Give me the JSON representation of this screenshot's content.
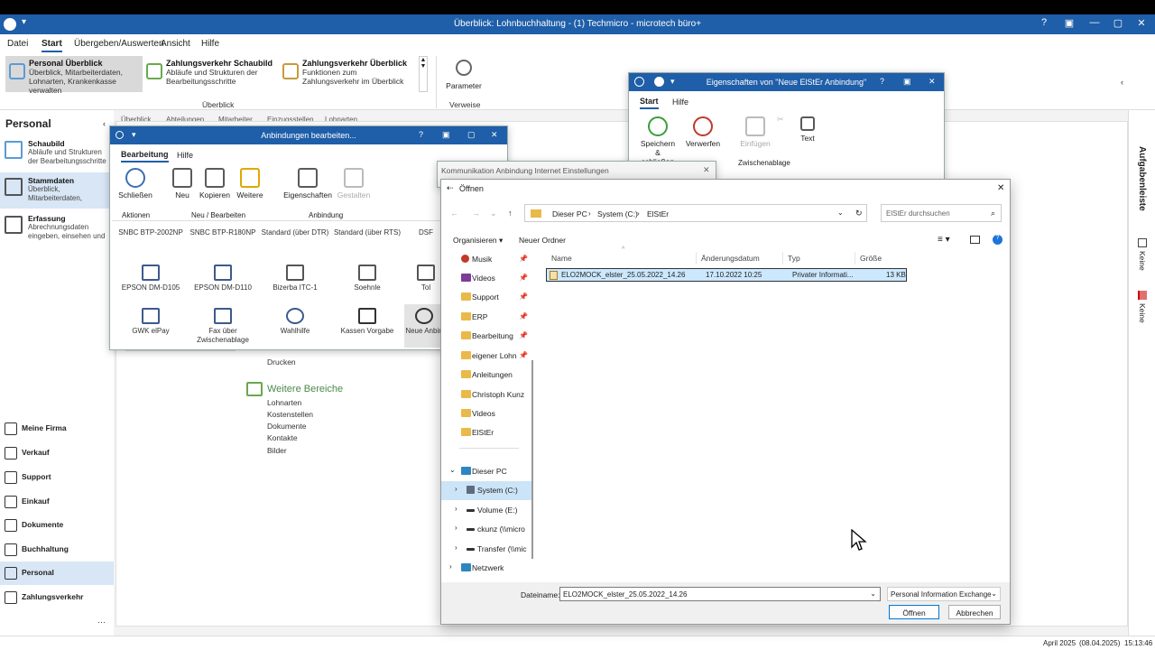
{
  "app": {
    "title": "Überblick: Lohnbuchhaltung - (1) Techmicro - microtech büro+",
    "window_buttons": [
      "?",
      "▣",
      "—",
      "▢",
      "✕"
    ]
  },
  "menu": [
    "Datei",
    "Start",
    "Übergeben/Auswerten",
    "Ansicht",
    "Hilfe"
  ],
  "ribbon": {
    "tiles": [
      {
        "title": "Personal Überblick",
        "desc": "Überblick, Mitarbeiterdaten, Lohnarten, Krankenkasse verwalten"
      },
      {
        "title": "Zahlungsverkehr Schaubild",
        "desc": "Abläufe und Strukturen der Bearbeitungsschritte"
      },
      {
        "title": "Zahlungsverkehr Überblick",
        "desc": "Funktionen zum Zahlungsverkehr im Überblick"
      }
    ],
    "group_overview": "Überblick",
    "param_label": "Parameter",
    "group_links": "Verweise"
  },
  "left": {
    "title": "Personal",
    "items": [
      {
        "title": "Schaubild",
        "desc": "Abläufe und Strukturen der Bearbeitungsschritte"
      },
      {
        "title": "Stammdaten",
        "desc": "Überblick, Mitarbeiterdaten,"
      },
      {
        "title": "Erfassung",
        "desc": "Abrechnungsdaten eingeben, einsehen und"
      }
    ],
    "nav": [
      "Meine Firma",
      "Verkauf",
      "Support",
      "Einkauf",
      "Dokumente",
      "Buchhaltung",
      "Personal",
      "Zahlungsverkehr"
    ],
    "more": "···"
  },
  "center": {
    "tabs": [
      "Überblick",
      "Abteilungen",
      "Mitarbeiter",
      "Einzugsstellen",
      "Lohnarten"
    ],
    "print": "Drucken",
    "more_title": "Weitere Bereiche",
    "more_links": [
      "Lohnarten",
      "Kostenstellen",
      "Dokumente",
      "Kontakte",
      "Bilder"
    ]
  },
  "rightbar": {
    "tasks": "Aufgabenleiste",
    "none1": "Keine",
    "none2": "Keine"
  },
  "status": {
    "date": "April 2025",
    "today": "(08.04.2025)",
    "time": "15:13:46"
  },
  "anbindungen": {
    "title": "Anbindungen bearbeiten...",
    "tabs": [
      "Bearbeitung",
      "Hilfe"
    ],
    "buttons": [
      "Schließen",
      "Neu",
      "Kopieren",
      "Weitere",
      "Eigenschaften",
      "Gestalten"
    ],
    "groups": [
      "Aktionen",
      "Neu / Bearbeiten",
      "Anbindung"
    ],
    "devices_row0": [
      "SNBC BTP-2002NP",
      "SNBC BTP-R180NP",
      "Standard (über DTR)",
      "Standard (über RTS)",
      "DSF"
    ],
    "devices_row1": [
      "EPSON DM-D105",
      "EPSON DM-D110",
      "Bizerba ITC-1",
      "Soehnle",
      "Tol"
    ],
    "devices_row2": [
      "GWK elPay",
      "Fax über Zwischenablage",
      "Wahlhilfe",
      "Kassen Vorgabe",
      "Neue Anbin"
    ]
  },
  "eigenschaften": {
    "title": "Eigenschaften von \"Neue ElStEr Anbindung\"",
    "tabs": [
      "Start",
      "Hilfe"
    ],
    "buttons": [
      "Speichern & schließen",
      "Verwerfen",
      "Einfügen",
      "Text"
    ],
    "group": "Zwischenablage"
  },
  "kommunikation": {
    "title": "Kommunikation Anbindung Internet Einstellungen"
  },
  "open": {
    "title": "Öffnen",
    "path": [
      "Dieser PC",
      "System (C:)",
      "ElStEr"
    ],
    "search_placeholder": "ElStEr durchsuchen",
    "organize": "Organisieren ▾",
    "new_folder": "Neuer Ordner",
    "quick": [
      {
        "name": "Musik",
        "pin": true
      },
      {
        "name": "Videos",
        "pin": true
      },
      {
        "name": "Support",
        "pin": true
      },
      {
        "name": "ERP",
        "pin": true
      },
      {
        "name": "Bearbeitung",
        "pin": true
      },
      {
        "name": "eigener Lohn",
        "pin": true
      },
      {
        "name": "Anleitungen",
        "pin": false
      },
      {
        "name": "Christoph Kunz",
        "pin": false
      },
      {
        "name": "Videos",
        "pin": false
      },
      {
        "name": "ElStEr",
        "pin": false
      }
    ],
    "pc": "Dieser PC",
    "drives": [
      "System (C:)",
      "Volume (E:)",
      "ckunz (\\\\micro",
      "Transfer (\\\\mic"
    ],
    "network": "Netzwerk",
    "columns": [
      "Name",
      "Änderungsdatum",
      "Typ",
      "Größe"
    ],
    "files": [
      {
        "name": "ELO2MOCK_elster_25.05.2022_14.26",
        "date": "17.10.2022 10:25",
        "type": "Privater Informati...",
        "size": "13 KB"
      }
    ],
    "filename_label": "Dateiname:",
    "filename_value": "ELO2MOCK_elster_25.05.2022_14.26",
    "filter": "Personal Information Exchange",
    "open_btn": "Öffnen",
    "cancel_btn": "Abbrechen"
  }
}
